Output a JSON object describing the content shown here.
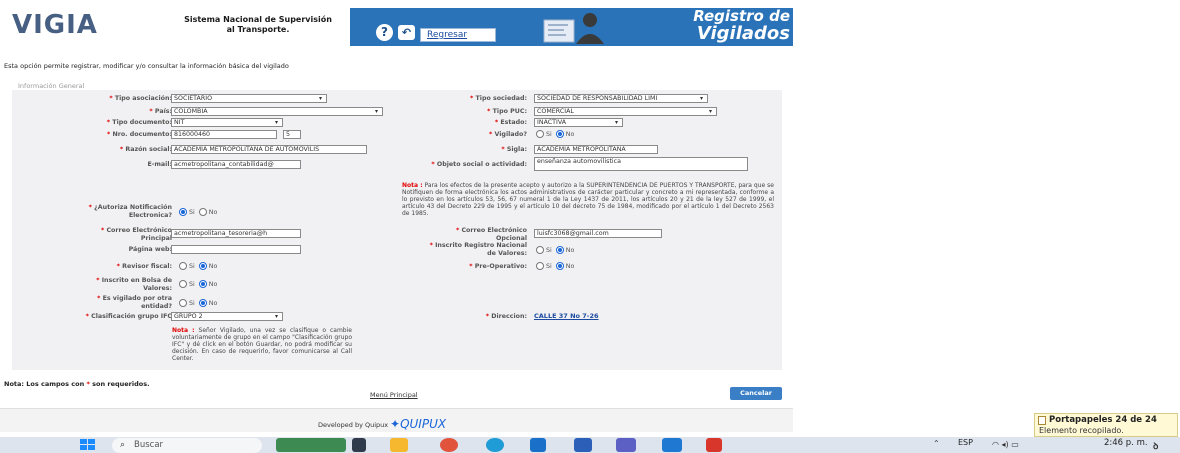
{
  "header": {
    "logo": "VIGIA",
    "logo_sub_1": "Sistema Nacional de Supervisión",
    "logo_sub_2": "al Transporte.",
    "back_label": "Regresar",
    "title_line1": "Registro de",
    "title_line2": "Vigilados",
    "brand_color": "#2a73b8"
  },
  "intro": "Esta opción permite registrar, modificar y/o consultar la información básica del vigilado",
  "section_title": "Información General",
  "form": {
    "tipo_asociacion": {
      "label": "Tipo asociación:",
      "value": "SOCIETARIO"
    },
    "tipo_sociedad": {
      "label": "Tipo sociedad:",
      "value": "SOCIEDAD DE RESPONSABILIDAD LIMI"
    },
    "pais": {
      "label": "País:",
      "value": "COLOMBIA"
    },
    "tipo_puc": {
      "label": "Tipo PUC:",
      "value": "COMERCIAL"
    },
    "tipo_documento": {
      "label": "Tipo documento:",
      "value": "NIT"
    },
    "estado": {
      "label": "Estado:",
      "value": "INACTIVA"
    },
    "nro_documento": {
      "label": "Nro. documento:",
      "value": "816000460",
      "dv": "5"
    },
    "vigilado": {
      "label": "Vigilado?",
      "options": [
        "Si",
        "No"
      ],
      "selected": "No"
    },
    "razon_social": {
      "label": "Razón social:",
      "value": "ACADEMIA METROPOLITANA DE AUTOMOVILIS"
    },
    "sigla": {
      "label": "Sigla:",
      "value": "ACADEMIA METROPOLITANA"
    },
    "email": {
      "label": "E-mail:",
      "value": "acmetropolitana_contabilidad@"
    },
    "objeto_social": {
      "label": "Objeto social o actividad:",
      "value": "enseñanza automovilistica"
    },
    "autoriza": {
      "label_1": "¿Autoriza Notificación",
      "label_2": "Electronica?",
      "options": [
        "Si",
        "No"
      ],
      "selected": "Si"
    },
    "nota_autoriza_title": "Nota :",
    "nota_autoriza_text": "Para los efectos de la presente acepto y autorizo a la SUPERINTENDENCIA DE PUERTOS Y TRANSPORTE, para que se Notifiquen de forma electrónica los actos administrativos de carácter particular y concreto a mi representada, conforme a lo previsto en los artículos 53, 56, 67 numeral 1 de la Ley 1437 de 2011, los artículos 20 y 21 de la ley 527 de 1999, el artículo 43 del Decreto 229 de 1995 y el artículo 10 del decreto 75 de 1984, modificado por el artículo 1 del Decreto 2563 de 1985.",
    "correo_principal": {
      "label_1": "Correo Electrónico",
      "label_2": "Principal",
      "value": "acmetropolitana_tesoreria@h"
    },
    "correo_opcional": {
      "label_1": "Correo Electrónico",
      "label_2": "Opcional",
      "value": "luisfc3068@gmail.com"
    },
    "pagina_web": {
      "label": "Página web:",
      "value": ""
    },
    "inscrito_rnv": {
      "label_1": "Inscrito Registro Nacional",
      "label_2": "de Valores:",
      "options": [
        "Si",
        "No"
      ],
      "selected": "No"
    },
    "revisor_fiscal": {
      "label": "Revisor fiscal:",
      "options": [
        "Si",
        "No"
      ],
      "selected": "No"
    },
    "pre_operativo": {
      "label": "Pre-Operativo:",
      "options": [
        "Si",
        "No"
      ],
      "selected": "No"
    },
    "inscrito_bolsa": {
      "label_1": "Inscrito en Bolsa de",
      "label_2": "Valores:",
      "options": [
        "Si",
        "No"
      ],
      "selected": "No"
    },
    "vigilado_otra": {
      "label_1": "Es vigilado por otra",
      "label_2": "entidad?",
      "options": [
        "Si",
        "No"
      ],
      "selected": "No"
    },
    "clasificacion_ifc": {
      "label": "Clasificación grupo IFC",
      "value": "GRUPO 2"
    },
    "direccion": {
      "label": "Direccion:",
      "value": "CALLE 37 No 7-26"
    },
    "nota_ifc_title": "Nota :",
    "nota_ifc_text": "Señor Vigilado, una vez se clasifique o cambie voluntariamente de grupo en el campo \"Clasificación grupo IFC\" y dé click en el botón Guardar, no podrá modificar su decisión. En caso de requerirlo, favor comunicarse al Call Center."
  },
  "required_note_1": "Nota: Los campos con",
  "required_note_star": "*",
  "required_note_2": "son requeridos.",
  "menu_link": "Menú Principal",
  "cancel_label": "Cancelar",
  "footer": {
    "text": "Developed by Quipux",
    "brand": "QUIPUX"
  },
  "notification": {
    "title": "Portapapeles 24 de 24",
    "body": "Elemento recopilado."
  },
  "taskbar": {
    "search_placeholder": "Buscar",
    "lang": "ESP",
    "time": "2:46 p. m."
  }
}
